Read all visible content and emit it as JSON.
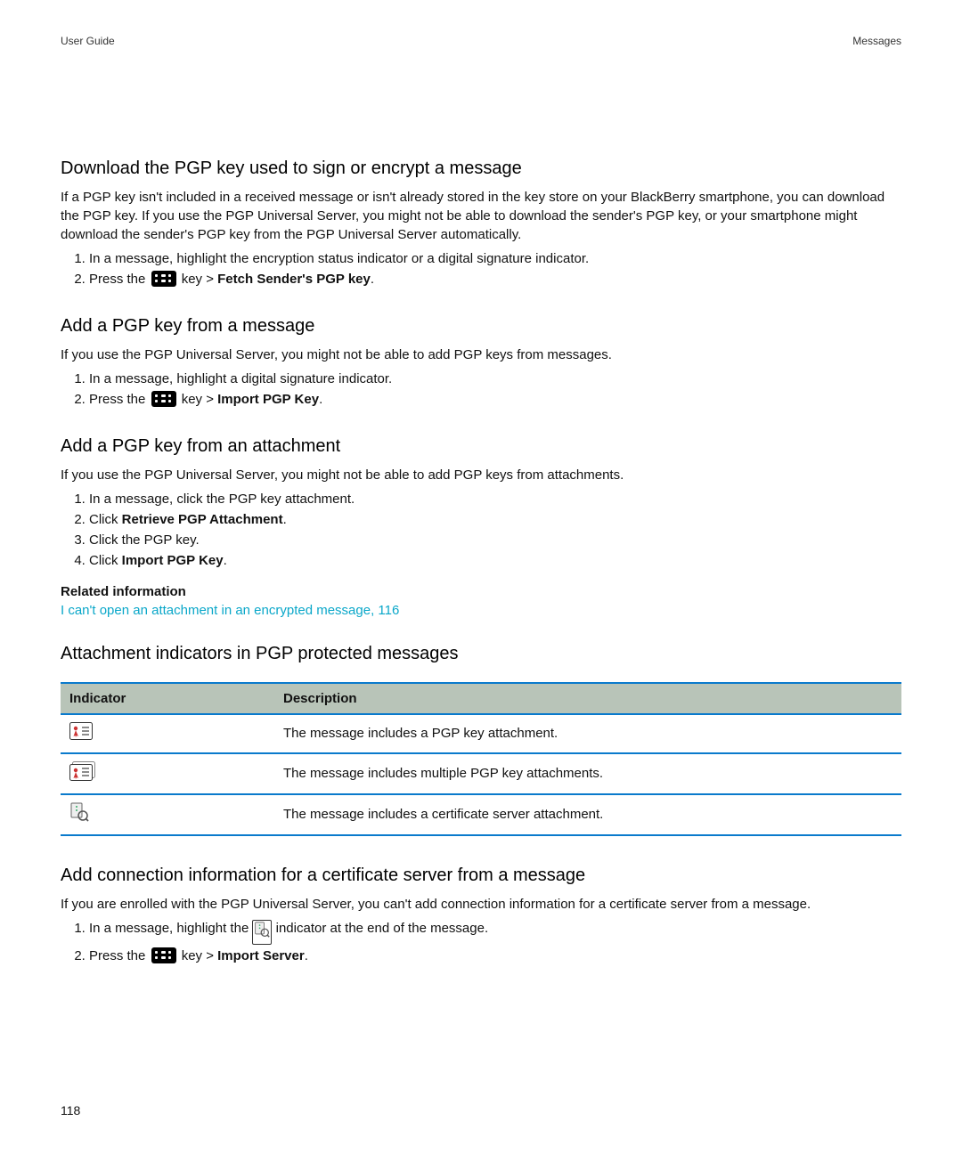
{
  "header": {
    "left": "User Guide",
    "right": "Messages"
  },
  "sections": {
    "download_pgp": {
      "heading": "Download the PGP key used to sign or encrypt a message",
      "para": "If a PGP key isn't included in a received message or isn't already stored in the key store on your BlackBerry smartphone, you can download the PGP key. If you use the PGP Universal Server, you might not be able to download the sender's PGP key, or your smartphone might download the sender's PGP key from the PGP Universal Server automatically.",
      "step1": "In a message, highlight the encryption status indicator or a digital signature indicator.",
      "step2_pre": "Press the ",
      "step2_mid": " key > ",
      "step2_bold": "Fetch Sender's PGP key",
      "step2_post": "."
    },
    "add_from_message": {
      "heading": "Add a PGP key from a message",
      "para": "If you use the PGP Universal Server, you might not be able to add PGP keys from messages.",
      "step1": "In a message, highlight a digital signature indicator.",
      "step2_pre": "Press the ",
      "step2_mid": " key > ",
      "step2_bold": "Import PGP Key",
      "step2_post": "."
    },
    "add_from_attachment": {
      "heading": "Add a PGP key from an attachment",
      "para": "If you use the PGP Universal Server, you might not be able to add PGP keys from attachments.",
      "step1": "In a message, click the PGP key attachment.",
      "step2_pre": "Click ",
      "step2_bold": "Retrieve PGP Attachment",
      "step2_post": ".",
      "step3": "Click the PGP key.",
      "step4_pre": "Click ",
      "step4_bold": "Import PGP Key",
      "step4_post": "."
    },
    "related": {
      "heading": "Related information",
      "link": "I can't open an attachment in an encrypted message, 116"
    },
    "indicators": {
      "heading": "Attachment indicators in PGP protected messages",
      "col1": "Indicator",
      "col2": "Description",
      "row1_desc": "The message includes a PGP key attachment.",
      "row2_desc": "The message includes multiple PGP key attachments.",
      "row3_desc": "The message includes a certificate server attachment."
    },
    "add_conn": {
      "heading": "Add connection information for a certificate server from a message",
      "para": "If you are enrolled with the PGP Universal Server, you can't add connection information for a certificate server from a message.",
      "step1_pre": "In a message, highlight the ",
      "step1_post": " indicator at the end of the message.",
      "step2_pre": "Press the ",
      "step2_mid": " key > ",
      "step2_bold": "Import Server",
      "step2_post": "."
    }
  },
  "page_number": "118"
}
